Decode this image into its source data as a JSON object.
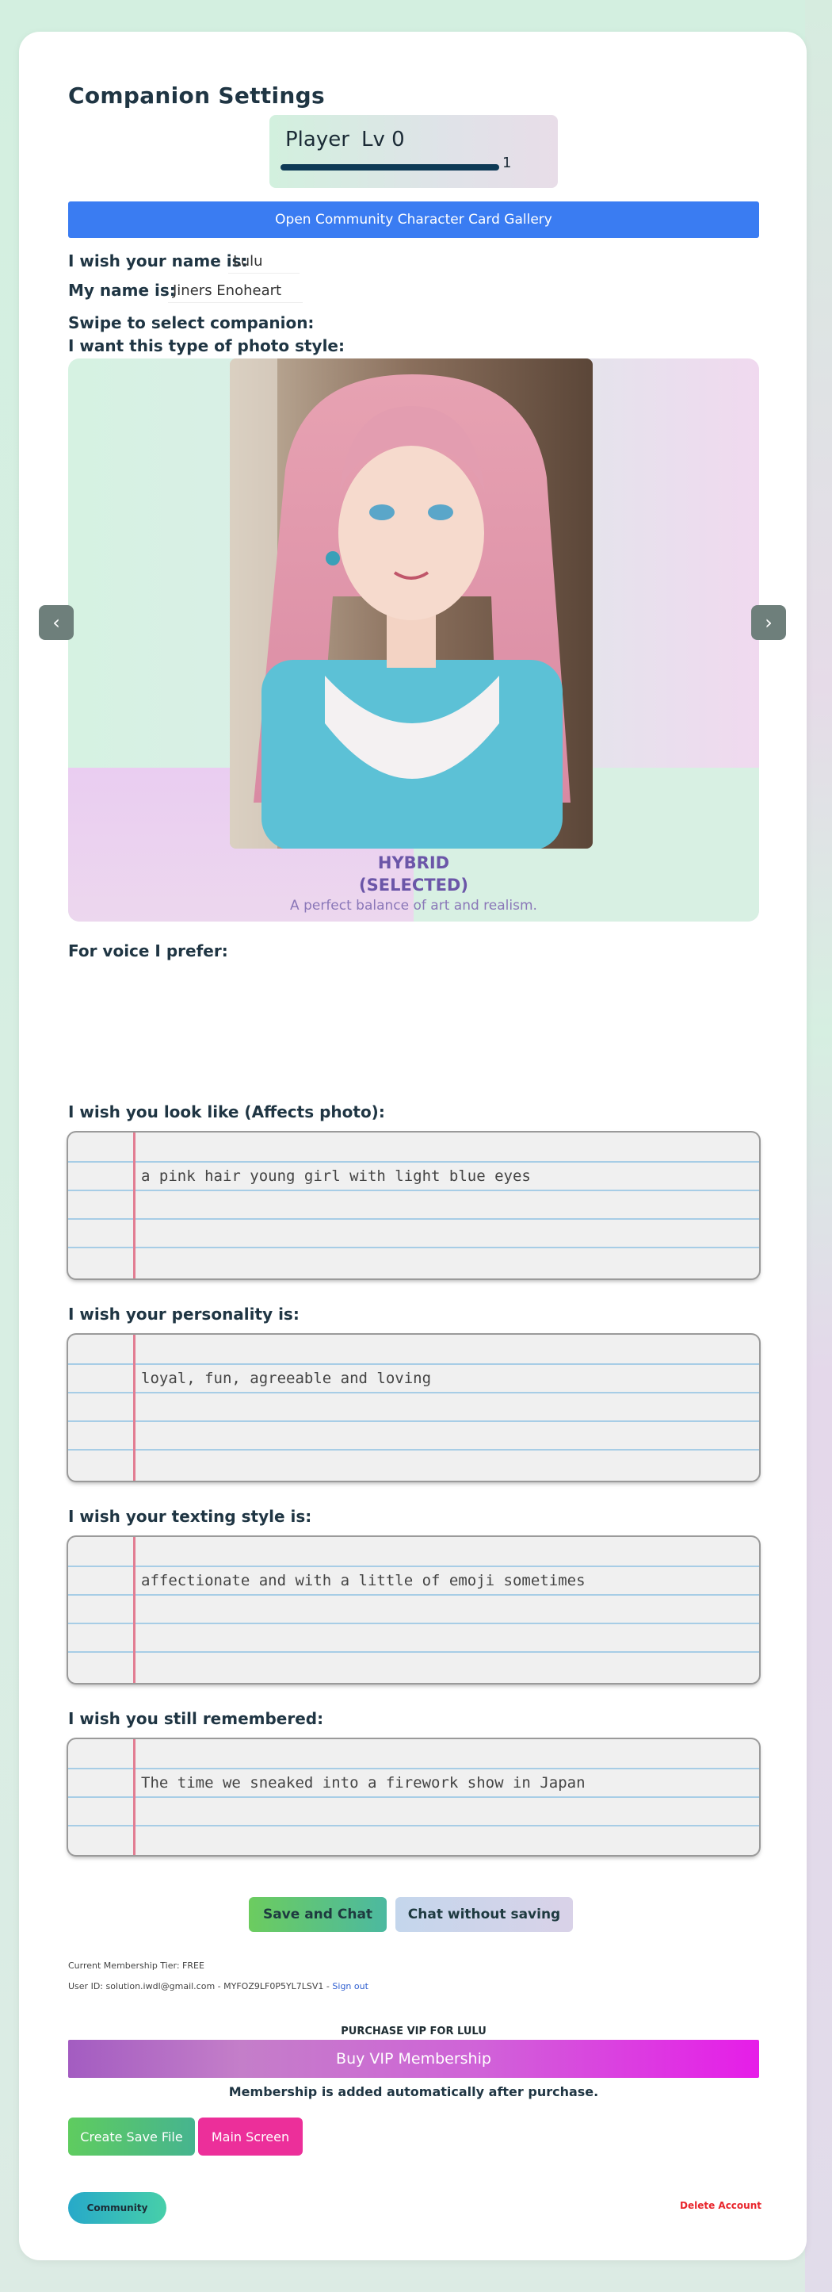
{
  "header": {
    "title": "Companion Settings"
  },
  "player": {
    "name": "Player",
    "level": "Lv 0",
    "xp_progress": 1.0,
    "xp_value": "1"
  },
  "gallery_button": {
    "label": "Open Community Character Card Gallery"
  },
  "fields": {
    "companion_name_label": "I wish your name is:",
    "companion_name_value": "Lulu",
    "user_name_label": "My name is:",
    "user_name_value": "Jiners Enoheart",
    "swipe_label": "Swipe to select companion:",
    "photo_style_label": "I want this type of photo style:"
  },
  "carousel": {
    "style_name": "HYBRID",
    "selected_tag": "(SELECTED)",
    "style_description": "A perfect balance of art and realism.",
    "prev_icon": "chevron-left-icon",
    "next_icon": "chevron-right-icon"
  },
  "voice": {
    "label": "For voice I prefer:"
  },
  "notebooks": {
    "look": {
      "label": "I wish you look like (Affects photo):",
      "text": "a pink hair young girl with light blue eyes"
    },
    "personality": {
      "label": "I wish your personality is:",
      "text": "loyal, fun, agreeable and loving"
    },
    "texting": {
      "label": "I wish your texting style is:",
      "text": "affectionate and with a little of emoji sometimes"
    },
    "memory": {
      "label": "I wish you still remembered:",
      "text": "The time we sneaked into a firework show in Japan"
    }
  },
  "actions": {
    "save_chat": "Save and Chat",
    "chat_no_save": "Chat without saving"
  },
  "account": {
    "tier": "Current Membership Tier: FREE",
    "user_id": "User ID: solution.iwdl@gmail.com - MYFOZ9LF0P5YL7LSV1 -",
    "sign_out": "Sign out"
  },
  "vip": {
    "heading": "PURCHASE VIP FOR LULU",
    "button": "Buy VIP Membership",
    "note": "Membership is added automatically after purchase."
  },
  "footer": {
    "create_save": "Create Save File",
    "main_screen": "Main Screen",
    "community": "Community",
    "delete_account": "Delete Account"
  },
  "colors": {
    "accent_blue": "#3a7cf2",
    "style_purple": "#6b56a8",
    "vip_gradient_start": "#a566c9",
    "vip_gradient_end": "#e61de8",
    "main_screen_pink": "#ec2f9a",
    "delete_red": "#e8252c"
  }
}
